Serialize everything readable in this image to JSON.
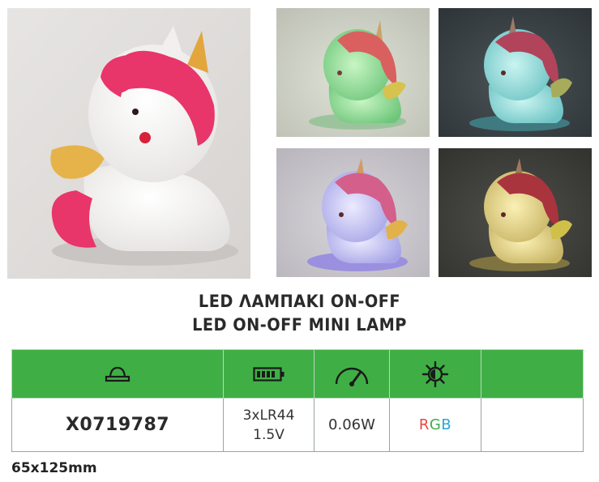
{
  "product": {
    "title_greek": "LED ΛΑΜΠΑΚΙ ON-OFF",
    "title_english": "LED ON-OFF MINI LAMP",
    "dimensions": "65x125mm"
  },
  "photos": [
    {
      "name": "photo-main",
      "variant": "white unicorn lamp, pink mane, gold horn"
    },
    {
      "name": "photo-green",
      "variant": "glowing green"
    },
    {
      "name": "photo-blue",
      "variant": "glowing blue"
    },
    {
      "name": "photo-violet",
      "variant": "glowing violet"
    },
    {
      "name": "photo-yellow",
      "variant": "glowing yellow"
    }
  ],
  "spec_table": {
    "header_color": "#3faf45",
    "header_icons": [
      "lamp-shade-icon",
      "battery-icon",
      "gauge-icon",
      "light-bulb-sun-icon",
      ""
    ],
    "code": "X0719787",
    "battery_line1": "3xLR44",
    "battery_line2": "1.5V",
    "power": "0.06W",
    "rgb": {
      "r": "R",
      "g": "G",
      "b": "B",
      "r_color": "#e8463f",
      "g_color": "#3faf45",
      "b_color": "#2aa6d8"
    }
  }
}
